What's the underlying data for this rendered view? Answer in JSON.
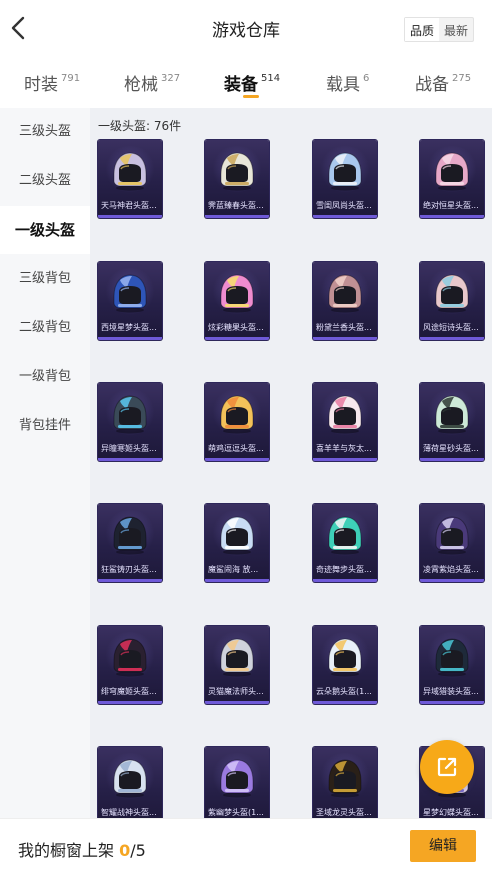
{
  "header": {
    "title": "游戏仓库",
    "sort_options": [
      "品质",
      "最新"
    ],
    "sort_selected": "品质"
  },
  "tabs": [
    {
      "label": "时装",
      "count": "791"
    },
    {
      "label": "枪械",
      "count": "327"
    },
    {
      "label": "装备",
      "count": "514"
    },
    {
      "label": "载具",
      "count": "6"
    },
    {
      "label": "战备",
      "count": "275"
    }
  ],
  "sidebar": {
    "items": [
      "三级头盔",
      "二级头盔",
      "一级头盔",
      "三级背包",
      "二级背包",
      "一级背包",
      "背包挂件"
    ],
    "active": "一级头盔"
  },
  "content": {
    "section_title": "一级头盔: 76件",
    "items": [
      {
        "name": "天马神君头盔...",
        "primary": "#c8c0e0",
        "accent": "#e8c45a"
      },
      {
        "name": "霁蓝臻春头盔...",
        "primary": "#e8e6d8",
        "accent": "#caa65a"
      },
      {
        "name": "雪闺凤尚头盔...",
        "primary": "#a9c8ee",
        "accent": "#eef2f8"
      },
      {
        "name": "绝对恒星头盔...",
        "primary": "#e6a8c8",
        "accent": "#f5d9e6"
      },
      {
        "name": "西境星梦头盔...",
        "primary": "#2e55b8",
        "accent": "#9ab6f0"
      },
      {
        "name": "炫彩糖果头盔...",
        "primary": "#ef8ccf",
        "accent": "#f7e06a"
      },
      {
        "name": "粉黛兰香头盔...",
        "primary": "#c09094",
        "accent": "#f0d0c8"
      },
      {
        "name": "风途短诗头盔...",
        "primary": "#e8c8cc",
        "accent": "#8ccce0"
      },
      {
        "name": "异瞳寒姬头盔...",
        "primary": "#3a4a58",
        "accent": "#5ac8f0"
      },
      {
        "name": "萌鸡逗逗头盔...",
        "primary": "#f3c25a",
        "accent": "#f08a3a"
      },
      {
        "name": "喜羊羊与灰太...",
        "primary": "#f7e8ee",
        "accent": "#e87aa0"
      },
      {
        "name": "薄荷星砂头盔...",
        "primary": "#cde9d8",
        "accent": "#2e3a34"
      },
      {
        "name": "狂鲨铸刃头盔...",
        "primary": "#1e2230",
        "accent": "#6aa6e0"
      },
      {
        "name": "魔鲨闹海 放...",
        "primary": "#c8dcf4",
        "accent": "#ffffff"
      },
      {
        "name": "奇迹舞步头盔...",
        "primary": "#3ed0b8",
        "accent": "#f4f4f4"
      },
      {
        "name": "凌霄紫焰头盔...",
        "primary": "#4a3a7a",
        "accent": "#d6d0f0"
      },
      {
        "name": "绯穹魔姬头盔...",
        "primary": "#2a2030",
        "accent": "#e0305a"
      },
      {
        "name": "灵猫魔法师头...",
        "primary": "#cfd2dc",
        "accent": "#f3c98a"
      },
      {
        "name": "云朵鹅头盔(1...",
        "primary": "#e8f0f8",
        "accent": "#f3c25a"
      },
      {
        "name": "异域猎装头盔...",
        "primary": "#1e2a3a",
        "accent": "#4ac6d6"
      },
      {
        "name": "智耀战神头盔...",
        "primary": "#d8e2f0",
        "accent": "#9ab0d0"
      },
      {
        "name": "紫幽梦头盔(1...",
        "primary": "#9a7ae0",
        "accent": "#d4c4f8"
      },
      {
        "name": "圣域龙灵头盔...",
        "primary": "#2a2018",
        "accent": "#d6a83a"
      },
      {
        "name": "星梦幻蝶头盔...",
        "primary": "#e4d6f4",
        "accent": "#7a6ad6"
      }
    ]
  },
  "bottom": {
    "label": "我的橱窗上架",
    "current": "0",
    "total": "/5",
    "edit_label": "编辑"
  },
  "icons": {
    "back": "chevron-left-icon",
    "fab": "share-external-icon"
  },
  "colors": {
    "accent": "#f5a623",
    "card_bg": "#262048",
    "card_bar": "#6f5ad8"
  }
}
